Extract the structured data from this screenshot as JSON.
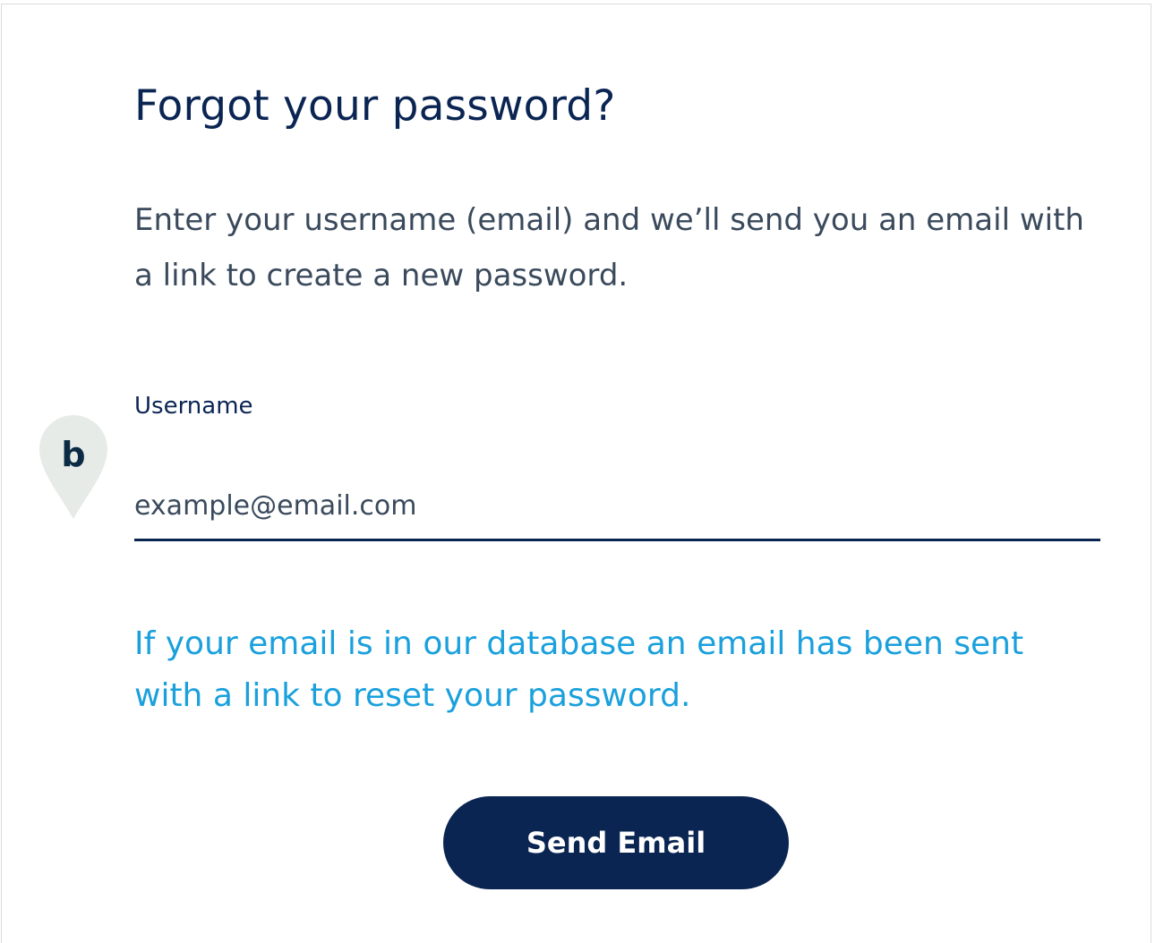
{
  "form": {
    "title": "Forgot your password?",
    "intro": "Enter your username (email) and we’ll send you an email with a link to create a new password.",
    "username_label": "Username",
    "username_placeholder": "example@email.com",
    "confirmation": "If your email is in our database an email has been sent with a link to reset your password.",
    "submit_label": "Send Email"
  },
  "marker": {
    "letter": "b",
    "icon": "map-pin-icon"
  },
  "colors": {
    "navy": "#0b2553",
    "body_text": "#3a4a5c",
    "link_blue": "#1aa0dc",
    "marker_fill": "#e6ebe8"
  }
}
